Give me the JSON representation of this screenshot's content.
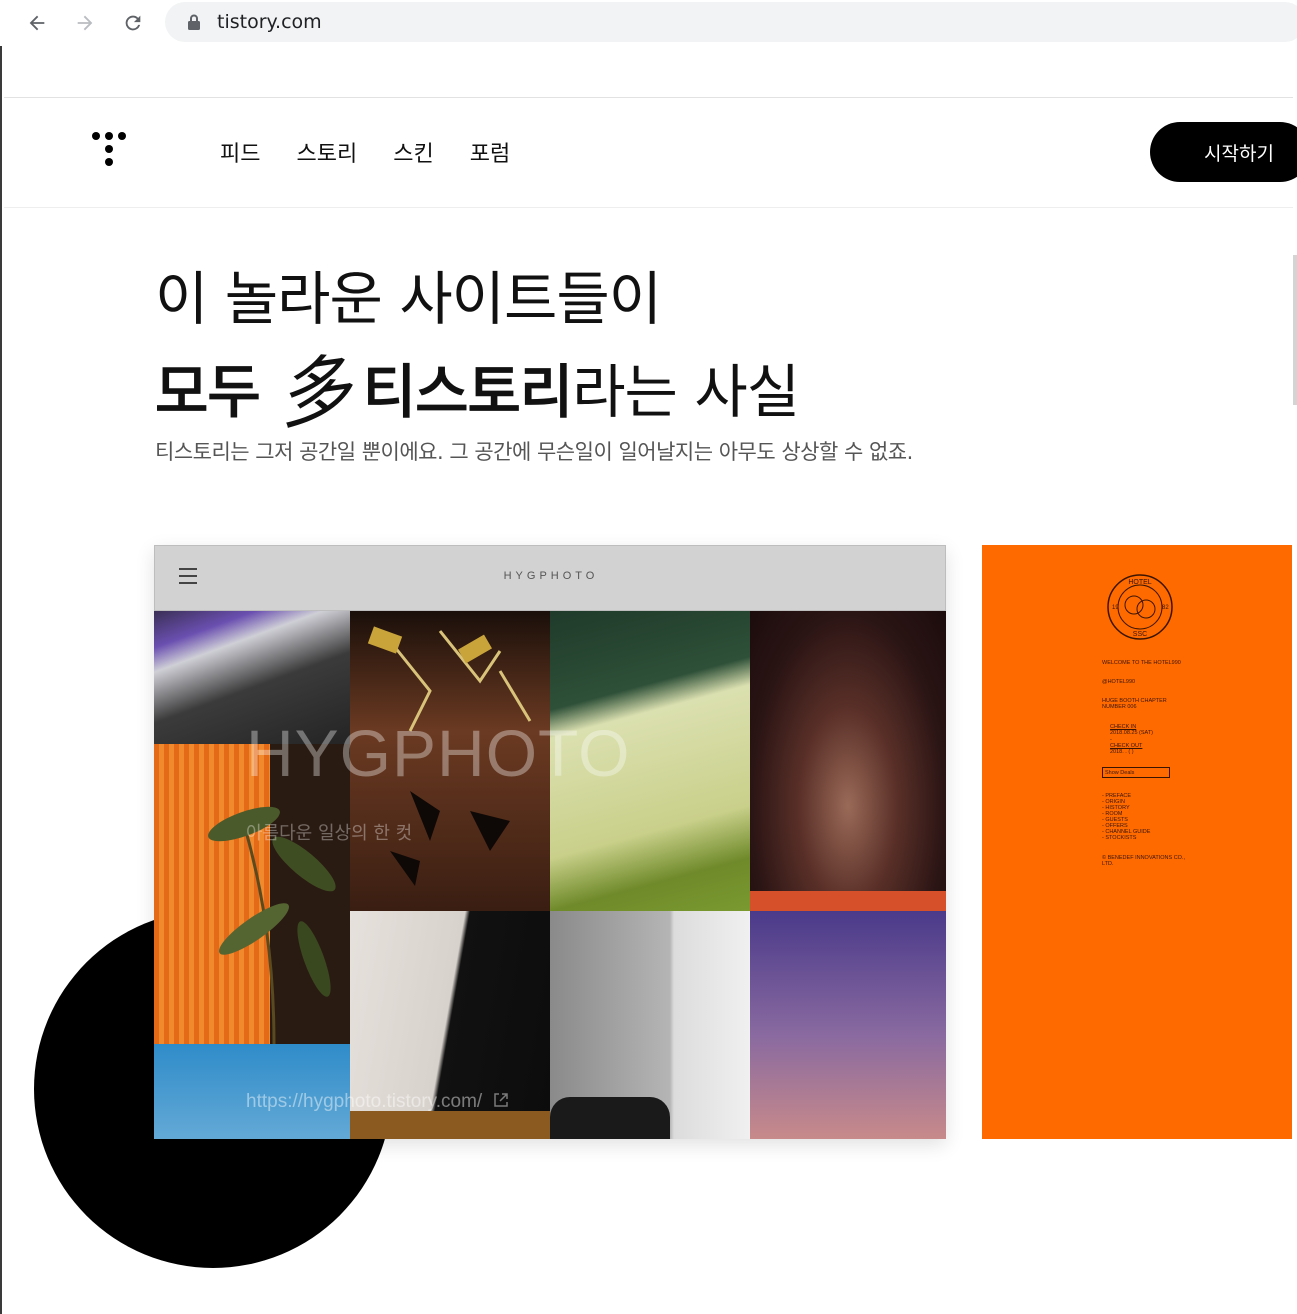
{
  "browser": {
    "url": "tistory.com"
  },
  "header": {
    "nav": [
      "피드",
      "스토리",
      "스킨",
      "포럼"
    ],
    "start_label": "시작하기"
  },
  "hero": {
    "line1": "이 놀라운 사이트들이",
    "line2_bold_a": "모두",
    "line2_hanja": "多",
    "line2_bold_b": "티스토리",
    "line2_rest": "라는 사실",
    "subtitle": "티스토리는 그저 공간일 뿐이에요. 그 공간에 무슨일이 일어날지는 아무도 상상할 수 없죠."
  },
  "showcase": {
    "card1": {
      "brand": "HYGPHOTO",
      "overlay_title": "HYGPHOTO",
      "overlay_sub": "아름다운 일상의 한 컷",
      "overlay_link": "https://hygphoto.tistory.com/"
    },
    "card2": {
      "seal_top": "HOTEL",
      "seal_left": "19",
      "seal_right": "82",
      "seal_bottom": "SSC",
      "welcome": "WELCOME TO THE HOTEL990",
      "handle": "@HOTEL990",
      "chapter1": "HUGE BOOTH CHAPTER",
      "chapter2": "NUMBER 006",
      "checkin_label": "CHECK IN",
      "checkin_date": "2018.08.25 (SAT)",
      "dash": "-",
      "checkout_label": "CHECK OUT",
      "checkout_date": "2018. . ( )",
      "deals": "Show Deals",
      "menu": [
        "- PREFACE",
        "- ORIGIN",
        "- HISTORY",
        "- ROOM",
        "- GUESTS",
        "- OFFERS",
        "- CHANNEL GUIDE",
        "- STOCKISTS"
      ],
      "copyright1": "© BENEDEF INNOVATIONS CO.,",
      "copyright2": "LTD."
    }
  },
  "colors": {
    "accent_orange": "#ff6a00",
    "button_black": "#000000"
  }
}
